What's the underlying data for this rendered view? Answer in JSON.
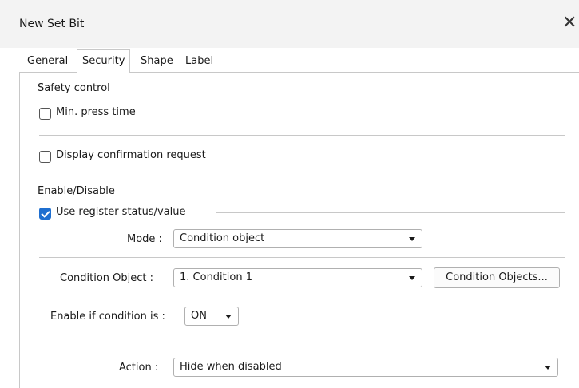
{
  "window": {
    "title": "New Set Bit",
    "close_icon": "close-icon"
  },
  "tabs": [
    {
      "label": "General",
      "active": false
    },
    {
      "label": "Security",
      "active": true
    },
    {
      "label": "Shape",
      "active": false
    },
    {
      "label": "Label",
      "active": false
    }
  ],
  "safety": {
    "legend": "Safety control",
    "min_press": {
      "label": "Min. press time",
      "checked": false
    },
    "confirm": {
      "label": "Display confirmation request",
      "checked": false
    }
  },
  "enable": {
    "legend": "Enable/Disable",
    "use_register": {
      "label": "Use register status/value",
      "checked": true
    },
    "mode": {
      "label": "Mode :",
      "value": "Condition object"
    },
    "condition_object": {
      "label": "Condition Object :",
      "value": "1. Condition 1",
      "button": "Condition Objects..."
    },
    "enable_if": {
      "label": "Enable if condition is :",
      "value": "ON"
    },
    "action": {
      "label": "Action :",
      "value": "Hide when disabled"
    }
  },
  "colors": {
    "accent": "#1f6fd0",
    "border": "#c8c8c8"
  }
}
